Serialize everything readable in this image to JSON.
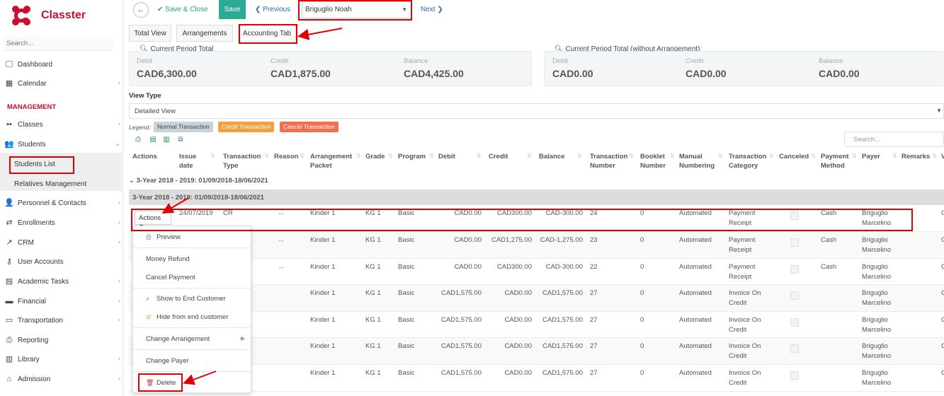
{
  "app": {
    "name": "Classter"
  },
  "sidebar": {
    "search_placeholder": "Search...",
    "section_label": "MANAGEMENT",
    "items": [
      {
        "label": "Dashboard",
        "icon": "monitor-icon"
      },
      {
        "label": "Calendar",
        "icon": "calendar-icon"
      },
      {
        "label": "Classes",
        "icon": "classes-icon"
      },
      {
        "label": "Students",
        "icon": "students-icon"
      },
      {
        "label": "Personnel & Contacts",
        "icon": "personnel-icon"
      },
      {
        "label": "Enrollments",
        "icon": "enrollments-icon"
      },
      {
        "label": "CRM",
        "icon": "crm-icon"
      },
      {
        "label": "User Accounts",
        "icon": "key-icon"
      },
      {
        "label": "Academic Tasks",
        "icon": "tasks-icon"
      },
      {
        "label": "Financial",
        "icon": "financial-icon"
      },
      {
        "label": "Transportation",
        "icon": "bus-icon"
      },
      {
        "label": "Reporting",
        "icon": "printer-icon"
      },
      {
        "label": "Library",
        "icon": "library-icon"
      },
      {
        "label": "Admission",
        "icon": "admission-icon"
      }
    ],
    "students_sub": [
      "Students List",
      "Relatives Management"
    ]
  },
  "topbar": {
    "save_close": "Save & Close",
    "save": "Save",
    "previous": "Previous",
    "student": "Briguglio Noah",
    "next": "Next"
  },
  "tabs": [
    "Total View",
    "Arrangements",
    "Accounting Tab"
  ],
  "summary": {
    "left": {
      "title": "Current Period Total",
      "debit_label": "Debit",
      "debit": "CAD6,300.00",
      "credit_label": "Credit",
      "credit": "CAD1,875.00",
      "balance_label": "Balance",
      "balance": "CAD4,425.00"
    },
    "right": {
      "title": "Current Period Total (without Arrangement)",
      "debit_label": "Debit",
      "debit": "CAD0.00",
      "credit_label": "Credit",
      "credit": "CAD0.00",
      "balance_label": "Balance",
      "balance": "CAD0.00"
    }
  },
  "view_type": {
    "label": "View Type",
    "value": "Detailed View"
  },
  "legend": {
    "label": "Legend:",
    "items": [
      {
        "label": "Normal Transaction",
        "color": "#c8d3dc"
      },
      {
        "label": "Credit Transaction",
        "color": "#f0a040"
      },
      {
        "label": "Cancel Transaction",
        "color": "#f07050"
      }
    ]
  },
  "table": {
    "search_placeholder": "Search...",
    "headers": {
      "actions": "Actions",
      "issue_date": "Issue date",
      "transaction_type": "Transaction Type",
      "reason": "Reason",
      "arrangement_packet": "Arrangement Packet",
      "grade": "Grade",
      "program": "Program",
      "debit": "Debit",
      "credit": "Credit",
      "balance": "Balance",
      "transaction_number": "Transaction Number",
      "booklet_number": "Booklet Number",
      "manual_numbering": "Manual Numbering",
      "transaction_category": "Transaction Category",
      "canceled": "Canceled",
      "payment_method": "Payment Method",
      "payer": "Payer",
      "remarks": "Remarks",
      "extra": "V"
    },
    "group_1": "3-Year 2018 - 2019: 01/09/2018-18/06/2021",
    "group_2": "3-Year 2018 - 2019: 01/09/2018-18/06/2021",
    "actions_label": "Actions",
    "rows": [
      {
        "issue_date": "24/07/2019",
        "type": "CR",
        "reason": "...",
        "packet": "Kinder 1",
        "grade": "KG 1",
        "program": "Basic",
        "debit": "CAD0.00",
        "credit": "CAD300.00",
        "balance": "CAD-300.00",
        "number": "24",
        "booklet": "0",
        "manual": "Automated",
        "cat1": "Payment",
        "cat2": "Receipt",
        "method": "Cash",
        "payer1": "Briguglio",
        "payer2": "Marcelino",
        "extra": "C"
      },
      {
        "issue_date": "",
        "type": "",
        "reason": "...",
        "packet": "Kinder 1",
        "grade": "KG 1",
        "program": "Basic",
        "debit": "CAD0.00",
        "credit": "CAD1,275.00",
        "balance": "CAD-1,275.00",
        "number": "23",
        "booklet": "0",
        "manual": "Automated",
        "cat1": "Payment",
        "cat2": "Receipt",
        "method": "Cash",
        "payer1": "Briguglio",
        "payer2": "Marcelino",
        "extra": "C"
      },
      {
        "issue_date": "",
        "type": "",
        "reason": "...",
        "packet": "Kinder 1",
        "grade": "KG 1",
        "program": "Basic",
        "debit": "CAD0.00",
        "credit": "CAD300.00",
        "balance": "CAD-300.00",
        "number": "22",
        "booklet": "0",
        "manual": "Automated",
        "cat1": "Payment",
        "cat2": "Receipt",
        "method": "Cash",
        "payer1": "Briguglio",
        "payer2": "Marcelino",
        "extra": "C"
      },
      {
        "issue_date": "",
        "type": "",
        "reason": "",
        "packet": "Kinder 1",
        "grade": "KG 1",
        "program": "Basic",
        "debit": "CAD1,575.00",
        "credit": "CAD0.00",
        "balance": "CAD1,575.00",
        "number": "27",
        "booklet": "0",
        "manual": "Automated",
        "cat1": "Invoice On",
        "cat2": "Credit",
        "method": "",
        "payer1": "Briguglio",
        "payer2": "Marcelino",
        "extra": "C"
      },
      {
        "issue_date": "",
        "type": "",
        "reason": "",
        "packet": "Kinder 1",
        "grade": "KG 1",
        "program": "Basic",
        "debit": "CAD1,575.00",
        "credit": "CAD0.00",
        "balance": "CAD1,575.00",
        "number": "27",
        "booklet": "0",
        "manual": "Automated",
        "cat1": "Invoice On",
        "cat2": "Credit",
        "method": "",
        "payer1": "Briguglio",
        "payer2": "Marcelino",
        "extra": "C"
      },
      {
        "issue_date": "",
        "type": "",
        "reason": "",
        "packet": "Kinder 1",
        "grade": "KG 1",
        "program": "Basic",
        "debit": "CAD1,575.00",
        "credit": "CAD0.00",
        "balance": "CAD1,575.00",
        "number": "27",
        "booklet": "0",
        "manual": "Automated",
        "cat1": "Invoice On",
        "cat2": "Credit",
        "method": "",
        "payer1": "Briguglio",
        "payer2": "Marcelino",
        "extra": "C"
      },
      {
        "issue_date": "",
        "type": "",
        "reason": "",
        "packet": "Kinder 1",
        "grade": "KG 1",
        "program": "Basic",
        "debit": "CAD1,575.00",
        "credit": "CAD0.00",
        "balance": "CAD1,575.00",
        "number": "27",
        "booklet": "0",
        "manual": "Automated",
        "cat1": "Invoice On",
        "cat2": "Credit",
        "method": "",
        "payer1": "Briguglio",
        "payer2": "Marcelino",
        "extra": "C"
      }
    ]
  },
  "actions_menu": {
    "preview": "Preview",
    "money_refund": "Money Refund",
    "cancel_payment": "Cancel Payment",
    "show_end_customer": "Show to End Customer",
    "hide_end_customer": "Hide from end customer",
    "change_arrangement": "Change Arrangement",
    "change_payer": "Change Payer",
    "delete": "Delete"
  },
  "colors": {
    "brand": "#c8102e",
    "save": "#2bab91",
    "highlight": "#e00000",
    "link": "#2b6cb0"
  }
}
